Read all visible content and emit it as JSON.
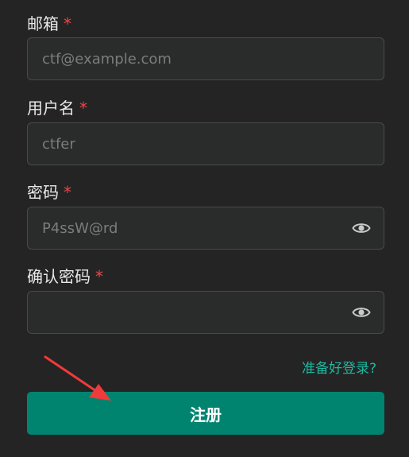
{
  "form": {
    "email": {
      "label": "邮箱",
      "required_mark": "*",
      "placeholder": "ctf@example.com",
      "value": ""
    },
    "username": {
      "label": "用户名",
      "required_mark": "*",
      "placeholder": "ctfer",
      "value": ""
    },
    "password": {
      "label": "密码",
      "required_mark": "*",
      "placeholder": "P4ssW@rd",
      "value": ""
    },
    "confirm_password": {
      "label": "确认密码",
      "required_mark": "*",
      "placeholder": "",
      "value": ""
    },
    "login_link": "准备好登录?",
    "submit_label": "注册"
  },
  "icons": {
    "password_toggle": "eye-icon",
    "confirm_toggle": "eye-icon",
    "annotation": "red-arrow"
  },
  "colors": {
    "background": "#242424",
    "input_background": "#2a2b2b",
    "required": "#e5484d",
    "link": "#1fb8a0",
    "primary_button": "#008470",
    "annotation_arrow": "#f23a3a"
  }
}
